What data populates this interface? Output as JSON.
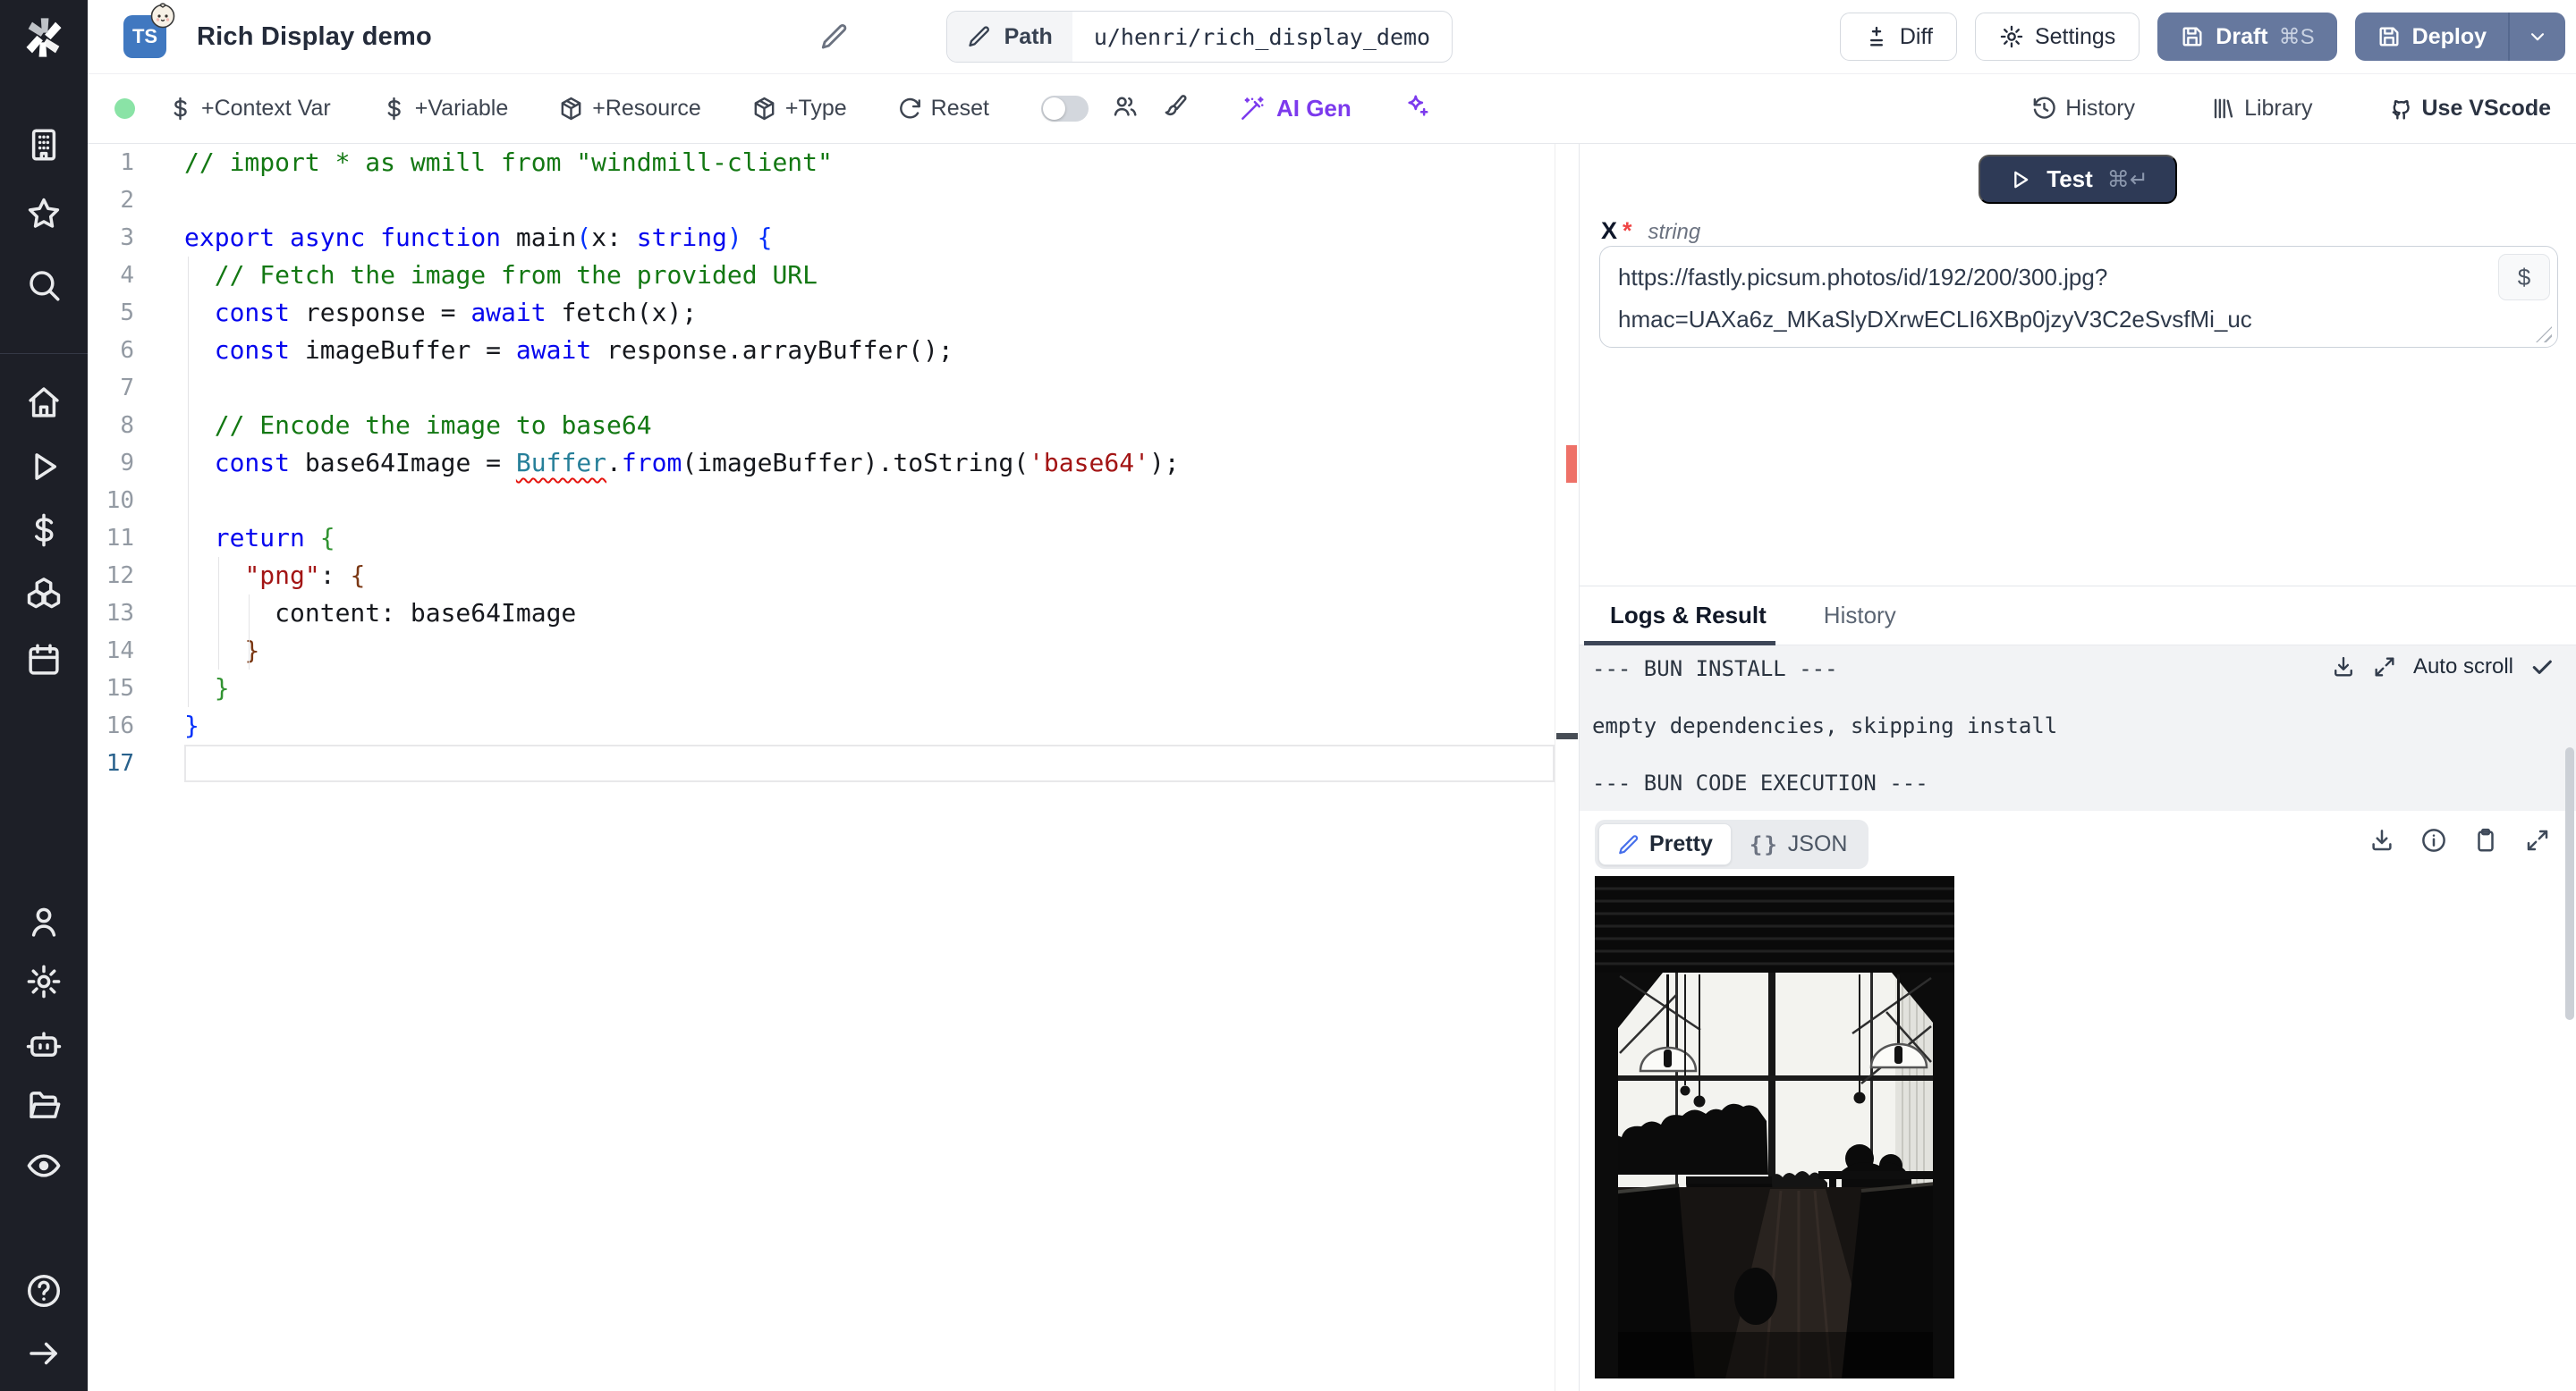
{
  "sidebar": {
    "icons": [
      "windmill-logo",
      "workspace",
      "favorites",
      "search",
      "home",
      "runs",
      "variables",
      "resources",
      "schedules",
      "user",
      "settings",
      "workers",
      "folders",
      "audit",
      "help",
      "collapse"
    ]
  },
  "header": {
    "badge": "TS",
    "title": "Rich Display demo",
    "path_label": "Path",
    "path_value": "u/henri/rich_display_demo",
    "diff_label": "Diff",
    "settings_label": "Settings",
    "draft_label": "Draft",
    "draft_shortcut": "⌘S",
    "deploy_label": "Deploy"
  },
  "toolbar": {
    "add_context_var": "+Context Var",
    "add_variable": "+Variable",
    "add_resource": "+Resource",
    "add_type": "+Type",
    "reset": "Reset",
    "ai_gen": "AI Gen",
    "history": "History",
    "library": "Library",
    "use_vscode": "Use VScode"
  },
  "editor": {
    "language": "typescript",
    "lines": [
      {
        "n": "1",
        "t": [
          [
            "c",
            "// import * as wmill from \"windmill-client\""
          ]
        ]
      },
      {
        "n": "2",
        "t": []
      },
      {
        "n": "3",
        "t": [
          [
            "k",
            "export"
          ],
          [
            "d",
            " "
          ],
          [
            "k",
            "async"
          ],
          [
            "d",
            " "
          ],
          [
            "k",
            "function"
          ],
          [
            "d",
            " main"
          ],
          [
            "b1",
            "("
          ],
          [
            "d",
            "x"
          ],
          [
            "d",
            ": "
          ],
          [
            "k",
            "string"
          ],
          [
            "b1",
            ")"
          ],
          [
            "d",
            " "
          ],
          [
            "b1",
            "{"
          ]
        ]
      },
      {
        "n": "4",
        "t": [
          [
            "d",
            "  "
          ],
          [
            "c",
            "// Fetch the image from the provided URL"
          ]
        ]
      },
      {
        "n": "5",
        "t": [
          [
            "d",
            "  "
          ],
          [
            "k",
            "const"
          ],
          [
            "d",
            " response = "
          ],
          [
            "k",
            "await"
          ],
          [
            "d",
            " fetch(x);"
          ]
        ]
      },
      {
        "n": "6",
        "t": [
          [
            "d",
            "  "
          ],
          [
            "k",
            "const"
          ],
          [
            "d",
            " imageBuffer = "
          ],
          [
            "k",
            "await"
          ],
          [
            "d",
            " response.arrayBuffer();"
          ]
        ]
      },
      {
        "n": "7",
        "t": []
      },
      {
        "n": "8",
        "t": [
          [
            "d",
            "  "
          ],
          [
            "c",
            "// Encode the image to base64"
          ]
        ]
      },
      {
        "n": "9",
        "t": [
          [
            "d",
            "  "
          ],
          [
            "k",
            "const"
          ],
          [
            "d",
            " base64Image = "
          ],
          [
            "t",
            "Buffer"
          ],
          [
            "d",
            "."
          ],
          [
            "k",
            "from"
          ],
          [
            "d",
            "(imageBuffer).toString("
          ],
          [
            "s",
            "'base64'"
          ],
          [
            "d",
            ");"
          ]
        ]
      },
      {
        "n": "10",
        "t": []
      },
      {
        "n": "11",
        "t": [
          [
            "d",
            "  "
          ],
          [
            "k",
            "return"
          ],
          [
            "d",
            " "
          ],
          [
            "b2",
            "{"
          ]
        ]
      },
      {
        "n": "12",
        "t": [
          [
            "d",
            "    "
          ],
          [
            "s",
            "\"png\""
          ],
          [
            "d",
            ": "
          ],
          [
            "b3",
            "{"
          ]
        ]
      },
      {
        "n": "13",
        "t": [
          [
            "d",
            "      content: base64Image"
          ]
        ]
      },
      {
        "n": "14",
        "t": [
          [
            "d",
            "    "
          ],
          [
            "b3",
            "}"
          ]
        ]
      },
      {
        "n": "15",
        "t": [
          [
            "d",
            "  "
          ],
          [
            "b2",
            "}"
          ]
        ]
      },
      {
        "n": "16",
        "t": [
          [
            "b1",
            "}"
          ]
        ]
      },
      {
        "n": "17",
        "t": [],
        "cur": true
      }
    ]
  },
  "runner": {
    "test_label": "Test",
    "test_shortcut": "⌘↵",
    "arg_name": "X",
    "arg_required_mark": "*",
    "arg_type": "string",
    "arg_value": "https://fastly.picsum.photos/id/192/200/300.jpg?hmac=UAXa6z_MKaSlyDXrwECLI6XBp0jzyV3C2eSvsfMi_uc",
    "arg_value_lines": [
      "https://fastly.picsum.photos/id/192/200/300.jpg?",
      "hmac=UAXa6z_MKaSlyDXrwECLI6XBp0jzyV3C2eSvsfMi_uc"
    ],
    "var_picker": "$"
  },
  "logs": {
    "tabs": [
      "Logs & Result",
      "History"
    ],
    "active_tab": "Logs & Result",
    "auto_scroll": "Auto scroll",
    "lines": [
      "--- BUN INSTALL ---",
      "",
      "empty dependencies, skipping install",
      "",
      "--- BUN CODE EXECUTION ---"
    ]
  },
  "result": {
    "pretty_tab": "Pretty",
    "json_tab": "JSON",
    "json_braces": "{}",
    "image_description": "black and white photo of cafe interior with large windows and silhouetted people"
  },
  "colors": {
    "accent_purple": "#7c3aed",
    "button_slate": "#66789e",
    "test_navy": "#2e3a56",
    "status_green": "#8ae3a6",
    "error_red": "#ee7168",
    "ts_badge_blue": "#4078c0"
  }
}
